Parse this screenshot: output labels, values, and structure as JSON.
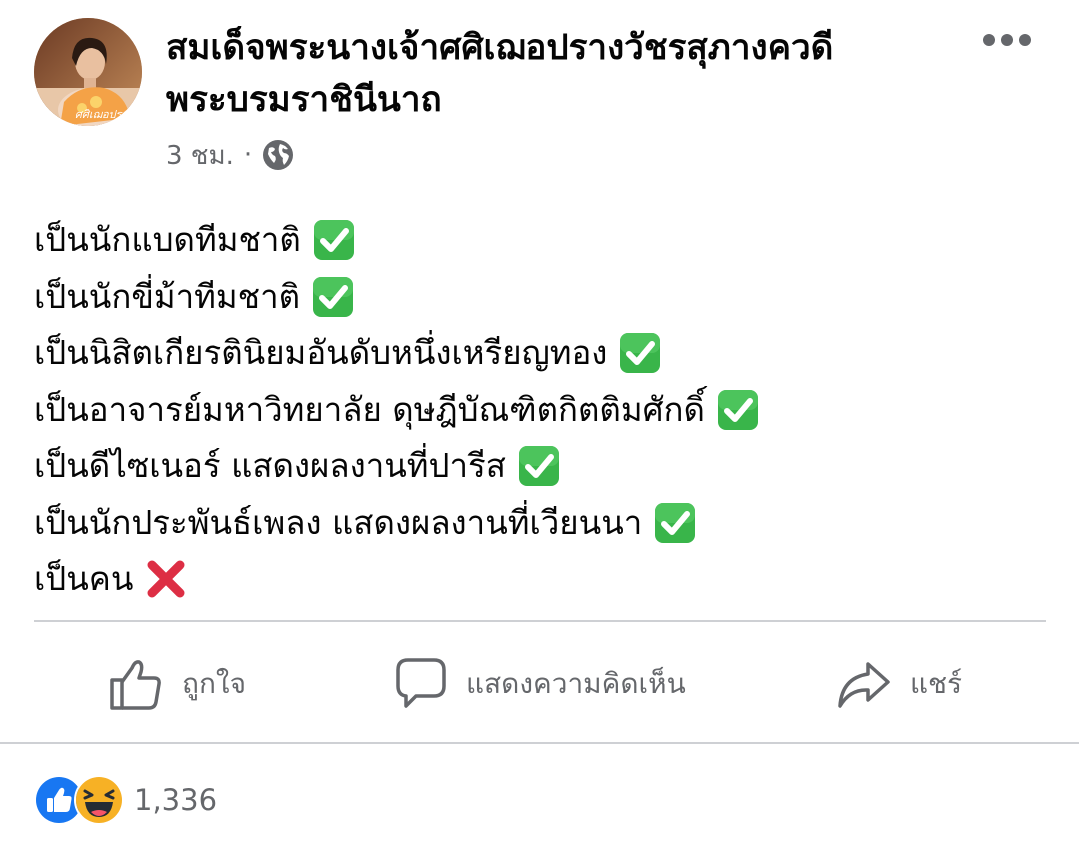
{
  "post": {
    "author_line1": "สมเด็จพระนางเจ้าศศิเฌอปรางวัชรสุภางควดี",
    "author_line2": "พระบรมราชินีนาถ",
    "avatar_watermark": "ศศิเฌอปราง",
    "time": "3 ชม.",
    "separator": "·",
    "audience_icon": "globe-icon",
    "lines": [
      {
        "text": "เป็นนักแบดทีมชาติ",
        "status": "check"
      },
      {
        "text": "เป็นนักขี่ม้าทีมชาติ",
        "status": "check"
      },
      {
        "text": "เป็นนิสิตเกียรตินิยมอันดับหนึ่งเหรียญทอง",
        "status": "check"
      },
      {
        "text": "เป็นอาจารย์มหาวิทยาลัย ดุษฎีบัณฑิตกิตติมศักดิ์",
        "status": "check"
      },
      {
        "text": "เป็นดีไซเนอร์ แสดงผลงานที่ปารีส",
        "status": "check"
      },
      {
        "text": "เป็นนักประพันธ์เพลง แสดงผลงานที่เวียนนา",
        "status": "check"
      },
      {
        "text": "เป็นคน",
        "status": "cross"
      }
    ]
  },
  "actions": {
    "like_label": "ถูกใจ",
    "comment_label": "แสดงความคิดเห็น",
    "share_label": "แชร์"
  },
  "reactions": {
    "count": "1,336",
    "icons": [
      "like-reaction-icon",
      "haha-reaction-icon"
    ]
  },
  "colors": {
    "check_green": "#39b54a",
    "cross_red": "#dd2e44",
    "like_blue": "#1877f2",
    "muted_text": "#65676b",
    "divider": "#ced0d4"
  }
}
